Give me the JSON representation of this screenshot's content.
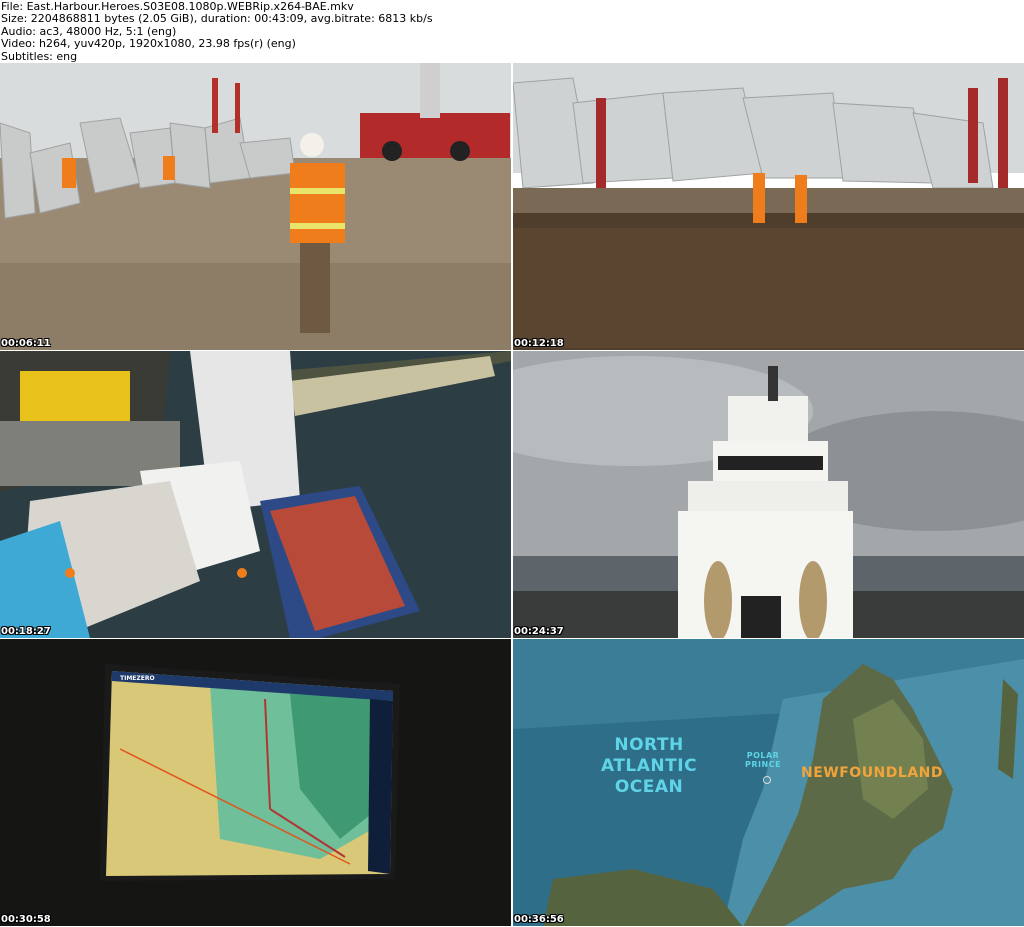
{
  "file_info": {
    "file": "File: East.Harbour.Heroes.S03E08.1080p.WEBRip.x264-BAE.mkv",
    "size": "Size: 2204868811 bytes (2.05 GiB), duration: 00:43:09, avg.bitrate: 6813 kb/s",
    "audio": "Audio: ac3, 48000 Hz, 5:1 (eng)",
    "video": "Video: h264, yuv420p, 1920x1080, 23.98 fps(r) (eng)",
    "subtitles": "Subtitles: eng"
  },
  "thumbnails": [
    {
      "timestamp": "00:06:11"
    },
    {
      "timestamp": "00:12:18"
    },
    {
      "timestamp": "00:18:27"
    },
    {
      "timestamp": "00:24:37"
    },
    {
      "timestamp": "00:30:58"
    },
    {
      "timestamp": "00:36:56"
    }
  ],
  "map": {
    "ocean_label_1": "NORTH",
    "ocean_label_2": "ATLANTIC",
    "ocean_label_3": "OCEAN",
    "town_label_1": "POLAR",
    "town_label_2": "PRINCE",
    "land_label": "NEWFOUNDLAND"
  },
  "screen": {
    "brand": "TIMEZERO"
  }
}
